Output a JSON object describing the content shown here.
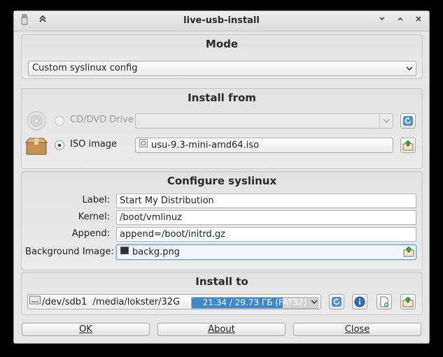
{
  "window": {
    "title": "live-usb-install"
  },
  "mode": {
    "title": "Mode",
    "selected": "Custom syslinux config"
  },
  "install_from": {
    "title": "Install from",
    "cd_label": "CD/DVD Drive",
    "cd_selected": "",
    "iso_label": "ISO image",
    "iso_value": "usu-9.3-mini-amd64.iso",
    "selected_source": "ISO image"
  },
  "syslinux": {
    "title": "Configure syslinux",
    "label_label": "Label:",
    "label_value": "Start My Distribution",
    "kernel_label": "Kernel:",
    "kernel_value": "/boot/vmlinuz",
    "append_label": "Append:",
    "append_value": "append=/boot/initrd.gz",
    "bg_label": "Background Image:",
    "bg_value": "backg.png"
  },
  "install_to": {
    "title": "Install to",
    "device": "/dev/sdb1",
    "mount": "/media/lokster/32G",
    "usage_text": "21.34 / 29.73 ГБ (FAT32)",
    "usage_fraction": 0.72
  },
  "buttons": {
    "ok": "OK",
    "about": "About",
    "close": "Close"
  },
  "colors": {
    "progress": "#3e88cf",
    "window_bg": "#e6e6e6",
    "focus": "#6aa0d8"
  }
}
